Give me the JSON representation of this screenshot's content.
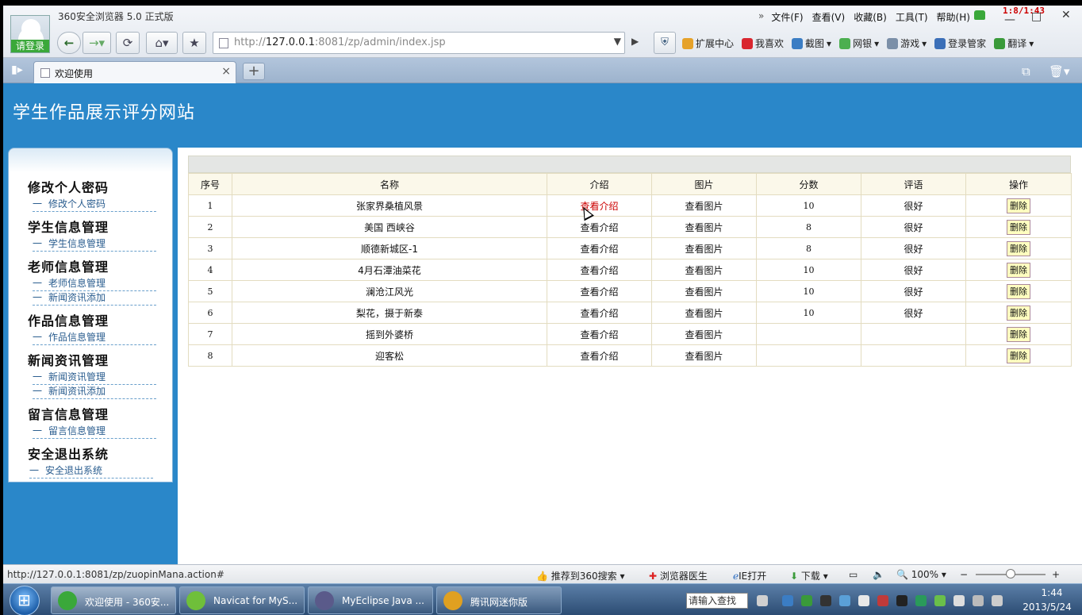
{
  "browser": {
    "title": "360安全浏览器 5.0 正式版",
    "login_label": "请登录",
    "menu": [
      "文件(F)",
      "查看(V)",
      "收藏(B)",
      "工具(T)",
      "帮助(H)"
    ],
    "menu_arrows": "»",
    "clock": "1:8/1:43",
    "win_min": "—",
    "win_max": "□",
    "win_close": "✕",
    "address": {
      "url_prefix": "http://",
      "url_host": "127.0.0.1",
      "url_rest": ":8081/zp/admin/index.jsp"
    },
    "toolbar": [
      {
        "label": "扩展中心",
        "icon": "extension-icon",
        "color": "#e6a22a"
      },
      {
        "label": "我喜欢",
        "icon": "heart-icon",
        "color": "#d9262f"
      },
      {
        "label": "截图",
        "icon": "screenshot-icon",
        "color": "#3b7dc4"
      },
      {
        "label": "网银",
        "icon": "bank-icon",
        "color": "#4caf50"
      },
      {
        "label": "游戏",
        "icon": "game-icon",
        "color": "#7b8fa8"
      },
      {
        "label": "登录管家",
        "icon": "key-icon",
        "color": "#3b6fb8"
      },
      {
        "label": "翻译",
        "icon": "translate-icon",
        "color": "#3a9a3a"
      }
    ],
    "tab": {
      "label": "欢迎使用",
      "close": "×"
    },
    "newtab": "+"
  },
  "site": {
    "title": "学生作品展示评分网站"
  },
  "nav": [
    {
      "heading": "修改个人密码",
      "links": [
        "修改个人密码"
      ]
    },
    {
      "heading": "学生信息管理",
      "links": [
        "学生信息管理"
      ]
    },
    {
      "heading": "老师信息管理",
      "links": [
        "老师信息管理",
        "新闻资讯添加"
      ]
    },
    {
      "heading": "作品信息管理",
      "links": [
        "作品信息管理"
      ]
    },
    {
      "heading": "新闻资讯管理",
      "links": [
        "新闻资讯管理",
        "新闻资讯添加"
      ]
    },
    {
      "heading": "留言信息管理",
      "links": [
        "留言信息管理"
      ]
    },
    {
      "heading": "安全退出系统",
      "links": [
        "安全退出系统"
      ]
    }
  ],
  "nav_link_prefix": "一",
  "table": {
    "columns": [
      "序号",
      "名称",
      "介绍",
      "图片",
      "分数",
      "评语",
      "操作"
    ],
    "rows": [
      {
        "no": "1",
        "name": "张家界桑植风景",
        "intro": "查看介绍",
        "pic": "查看图片",
        "score": "10",
        "comment": "很好",
        "action": "删除"
      },
      {
        "no": "2",
        "name": "美国 西峡谷",
        "intro": "查看介绍",
        "pic": "查看图片",
        "score": "8",
        "comment": "很好",
        "action": "删除"
      },
      {
        "no": "3",
        "name": "顺德新城区-1",
        "intro": "查看介绍",
        "pic": "查看图片",
        "score": "8",
        "comment": "很好",
        "action": "删除"
      },
      {
        "no": "4",
        "name": "4月石潭油菜花",
        "intro": "查看介绍",
        "pic": "查看图片",
        "score": "10",
        "comment": "很好",
        "action": "删除"
      },
      {
        "no": "5",
        "name": "澜沧江风光",
        "intro": "查看介绍",
        "pic": "查看图片",
        "score": "10",
        "comment": "很好",
        "action": "删除"
      },
      {
        "no": "6",
        "name": "梨花，摄于新泰",
        "intro": "查看介绍",
        "pic": "查看图片",
        "score": "10",
        "comment": "很好",
        "action": "删除"
      },
      {
        "no": "7",
        "name": "摇到外婆桥",
        "intro": "查看介绍",
        "pic": "查看图片",
        "score": "",
        "comment": "",
        "action": "删除"
      },
      {
        "no": "8",
        "name": "迎客松",
        "intro": "查看介绍",
        "pic": "查看图片",
        "score": "",
        "comment": "",
        "action": "删除"
      }
    ],
    "hover_color": "#cc0000"
  },
  "status": {
    "url": "http://127.0.0.1:8081/zp/zuopinMana.action#",
    "recommend": "推荐到360搜索",
    "doctor": "浏览器医生",
    "ie": "IE打开",
    "download": "下载",
    "zoom": "100%",
    "zoom_minus": "−",
    "zoom_plus": "+"
  },
  "taskbar": {
    "tasks": [
      {
        "label": "欢迎使用 - 360安...",
        "icon_color": "#3aa83a",
        "active": true
      },
      {
        "label": "Navicat for MyS...",
        "icon_color": "#6fbf3a",
        "active": false
      },
      {
        "label": "MyEclipse Java ...",
        "icon_color": "#5a5a8a",
        "active": false
      },
      {
        "label": "腾讯网迷你版",
        "icon_color": "#e0a020",
        "active": false
      }
    ],
    "search_placeholder": "请输入查找",
    "time": "1:44",
    "date": "2013/5/24"
  }
}
